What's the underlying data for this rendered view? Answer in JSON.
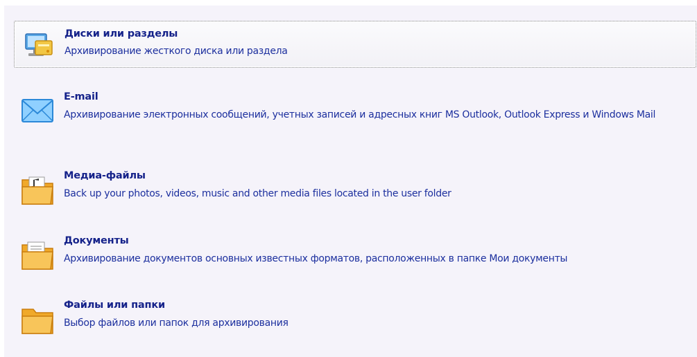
{
  "items": [
    {
      "title": "Диски или разделы",
      "description": "Архивирование жесткого диска или раздела",
      "icon": "computer-monitor-icon",
      "selected": true
    },
    {
      "title": "E-mail",
      "description": "Архивирование электронных сообщений, учетных записей и адресных книг MS Outlook, Outlook Express и Windows Mail",
      "icon": "envelope-icon",
      "selected": false
    },
    {
      "title": "Медиа-файлы",
      "description": "Back up your photos, videos, music and other media files located in the user folder",
      "icon": "media-folder-icon",
      "selected": false
    },
    {
      "title": "Документы",
      "description": "Архивирование документов основных известных форматов, расположенных в папке Мои документы",
      "icon": "documents-folder-icon",
      "selected": false
    },
    {
      "title": "Файлы или папки",
      "description": "Выбор файлов или папок для архивирования",
      "icon": "folder-icon",
      "selected": false
    }
  ],
  "colors": {
    "title": "#15228a",
    "description": "#1c2f9e",
    "background": "#f5f3fa",
    "folder": "#f5b23a",
    "envelope": "#3a9be6"
  }
}
